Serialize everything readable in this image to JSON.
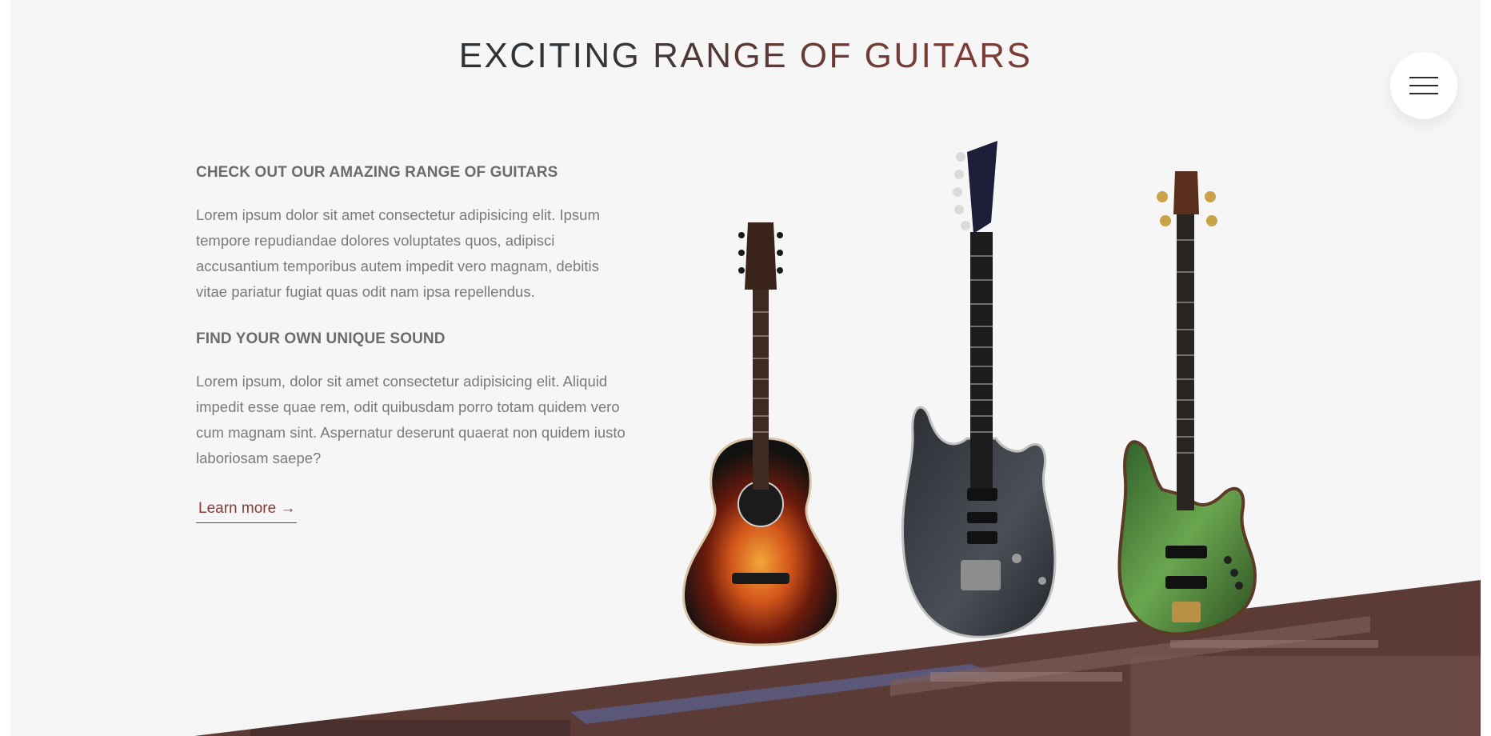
{
  "header": {
    "title": "EXCITING RANGE OF GUITARS"
  },
  "menu": {
    "icon": "hamburger-menu-icon"
  },
  "content": {
    "heading_1": "CHECK OUT OUR AMAZING RANGE OF GUITARS",
    "paragraph_1": "Lorem ipsum dolor sit amet consectetur adipisicing elit. Ipsum tempore repudiandae dolores voluptates quos, adipisci accusantium temporibus autem impedit vero magnam, debitis vitae pariatur fugiat quas odit nam ipsa repellendus.",
    "heading_2": "FIND YOUR OWN UNIQUE SOUND",
    "paragraph_2": "Lorem ipsum, dolor sit amet consectetur adipisicing elit. Aliquid impedit esse quae rem, odit quibusdam porro totam quidem vero cum magnam sint. Aspernatur deserunt quaerat non quidem iusto laboriosam saepe?",
    "learn_more": "Learn more →"
  },
  "products": [
    {
      "name": "acoustic-guitar",
      "color": "#c8521a"
    },
    {
      "name": "electric-guitar",
      "color": "#3d4046"
    },
    {
      "name": "bass-guitar",
      "color": "#4f8a3a"
    }
  ],
  "colors": {
    "accent": "#8a3c35",
    "background": "#f6f6f6",
    "band": "#5b3a36"
  }
}
